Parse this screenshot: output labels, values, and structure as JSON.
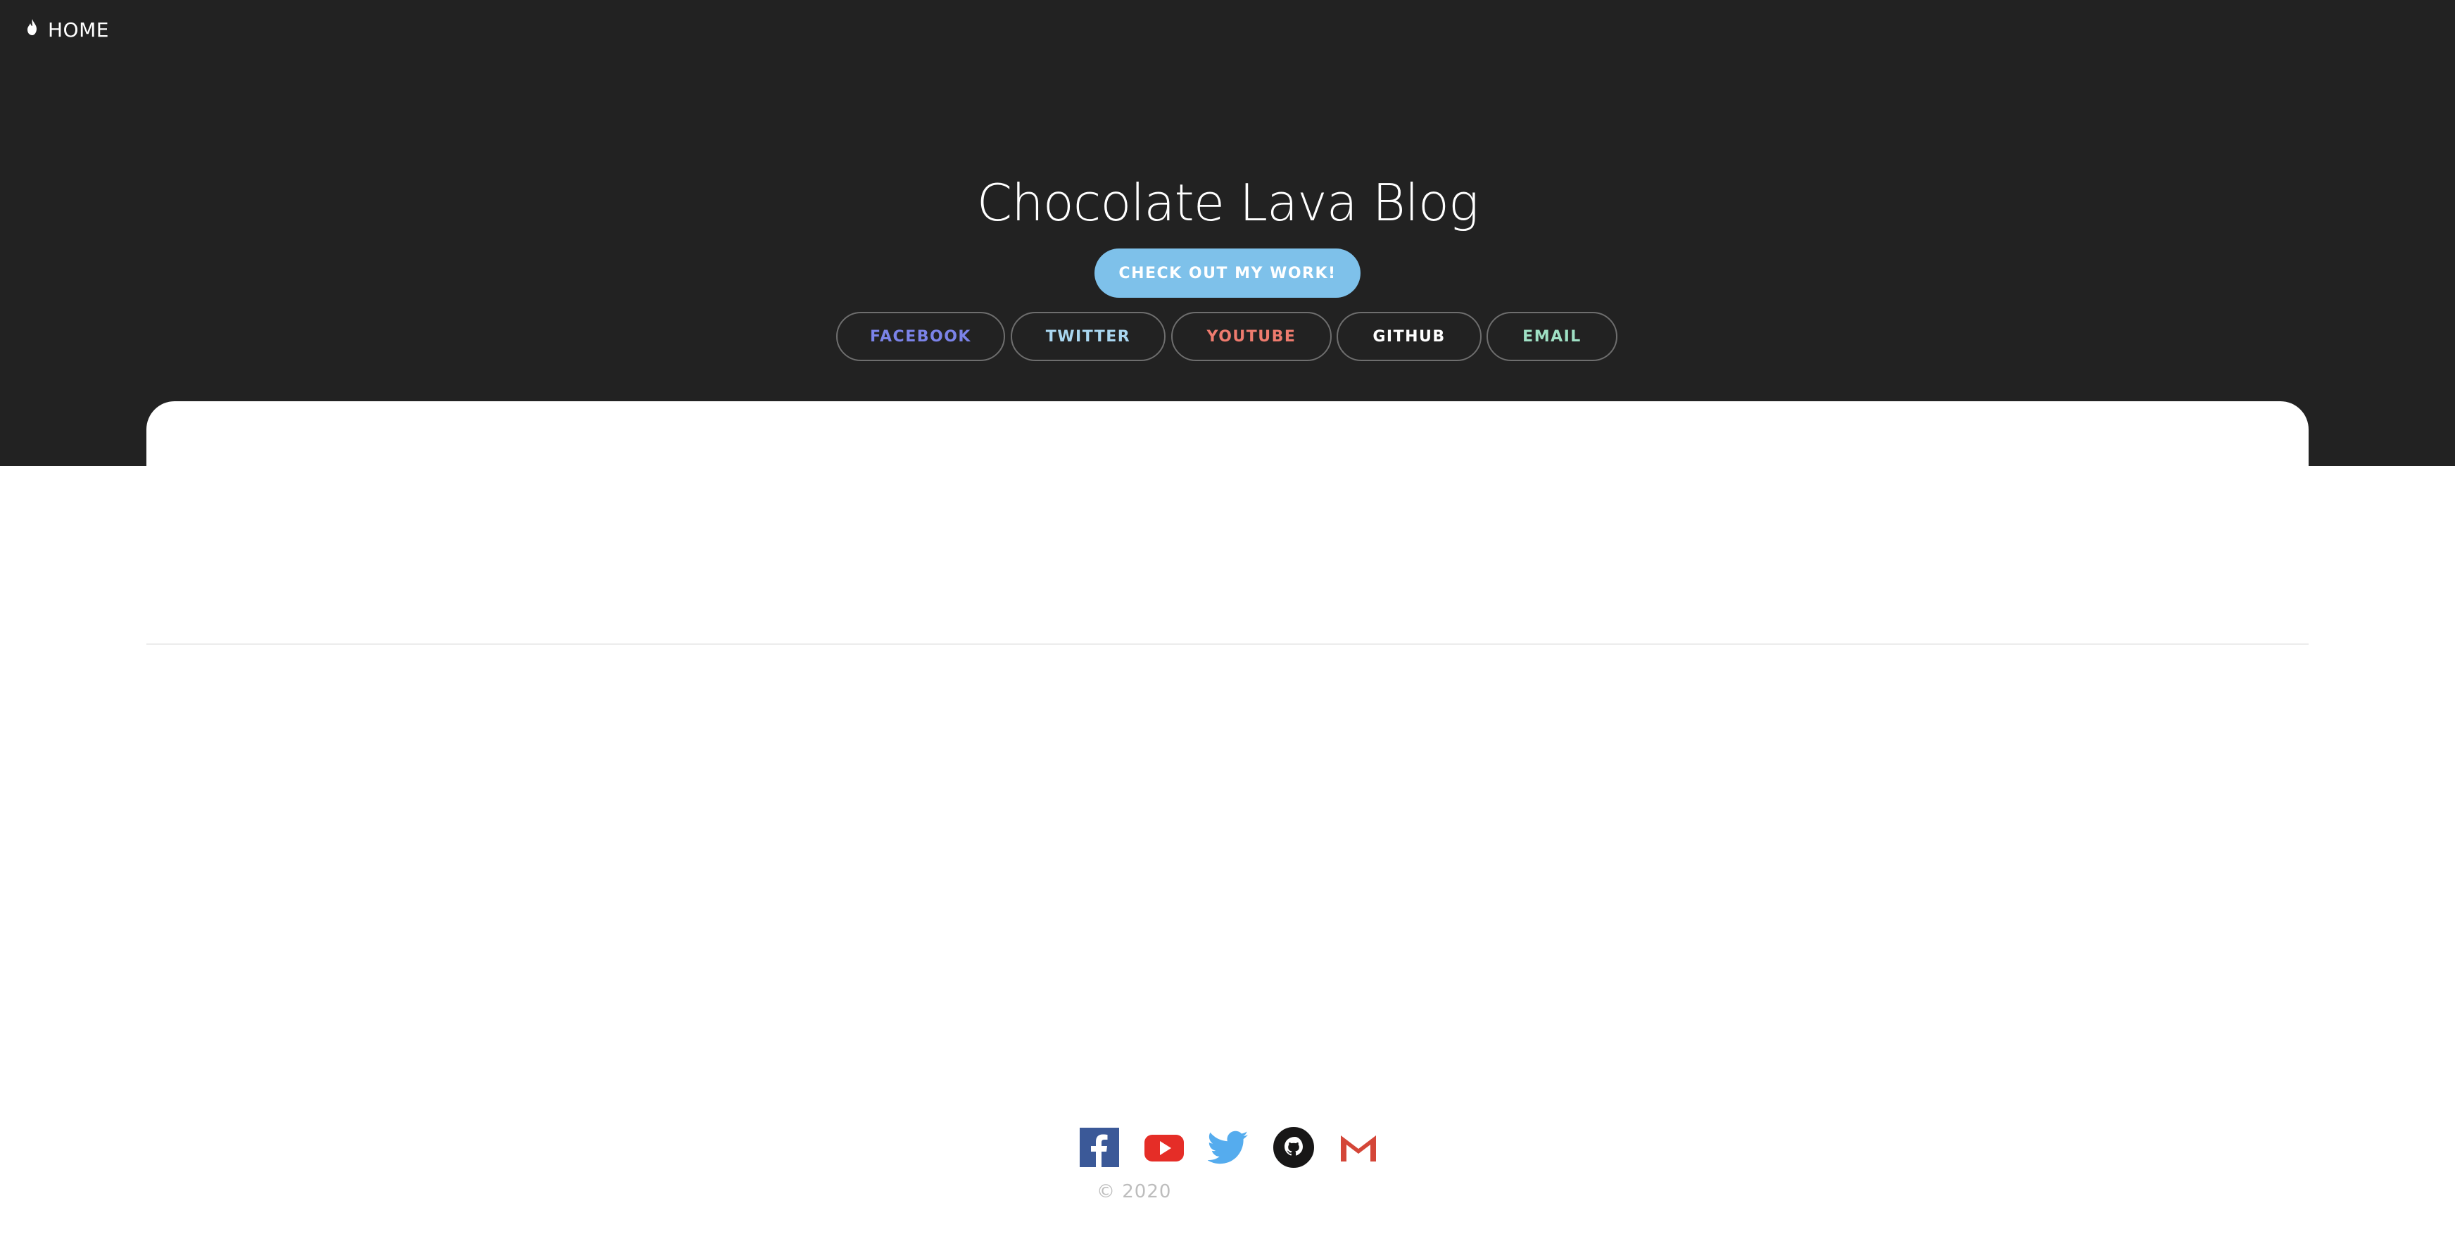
{
  "nav": {
    "home_label": "HOME"
  },
  "hero": {
    "title": "Chocolate Lava Blog",
    "cta_label": "CHECK OUT MY WORK!",
    "social_links": [
      {
        "label": "FACEBOOK",
        "color": "#7b83e8"
      },
      {
        "label": "TWITTER",
        "color": "#a9d6f0"
      },
      {
        "label": "YOUTUBE",
        "color": "#ee7b6e"
      },
      {
        "label": "GITHUB",
        "color": "#ffffff"
      },
      {
        "label": "EMAIL",
        "color": "#9fe0c4"
      }
    ]
  },
  "footer": {
    "icons": [
      "facebook-icon",
      "youtube-icon",
      "twitter-icon",
      "github-icon",
      "gmail-icon"
    ],
    "copyright": "© 2020"
  },
  "colors": {
    "hero_background": "#222222",
    "cta_background": "#7ec1ea",
    "facebook": "#3b5998",
    "youtube": "#e52d27",
    "twitter": "#55acee",
    "github": "#181717",
    "gmail": "#d44638"
  }
}
